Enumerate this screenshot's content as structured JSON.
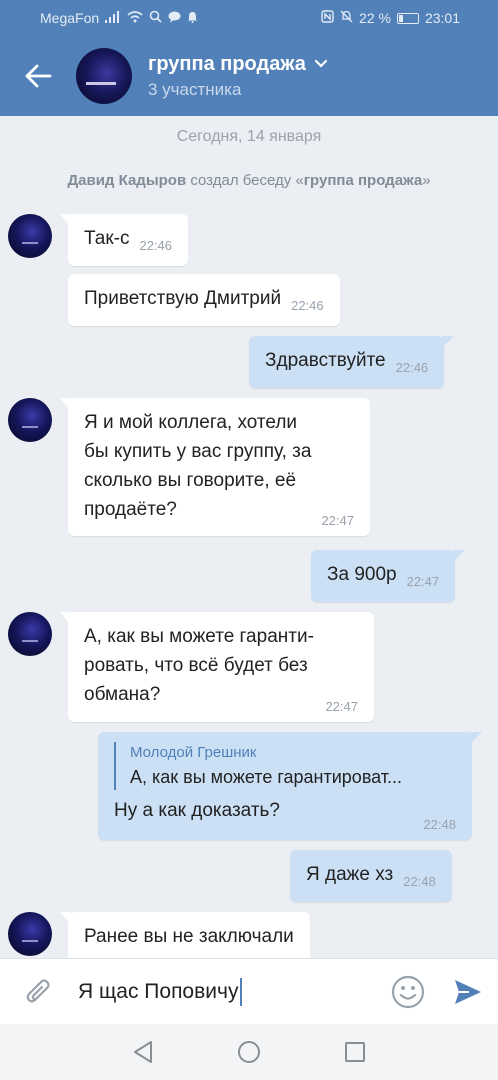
{
  "status_bar": {
    "carrier": "MegaFon",
    "battery": "22 %",
    "time": "23:01"
  },
  "header": {
    "title": "группа продажа",
    "subtitle": "3 участника"
  },
  "chat": {
    "date_separator": "Сегодня, 14 января",
    "system_message": {
      "author": "Давид Кадыров",
      "action": " создал беседу «",
      "chat_name": "группа продажа",
      "end": "»"
    },
    "messages": [
      {
        "direction": "in",
        "text": "Так-с",
        "time": "22:46"
      },
      {
        "direction": "in",
        "text": "Приветствую Дмитрий",
        "time": "22:46"
      },
      {
        "direction": "out",
        "text": "Здравствуйте",
        "time": "22:46"
      },
      {
        "direction": "in",
        "lines": [
          "Я и мой коллега, хотели",
          "бы купить у вас группу, за",
          "сколько вы говорите, её",
          "продаёте?"
        ],
        "time": "22:47"
      },
      {
        "direction": "out",
        "text": "За 900р",
        "time": "22:47"
      },
      {
        "direction": "in",
        "lines": [
          "А, как вы можете гаранти-",
          "ровать, что всё будет без",
          "обмана?"
        ],
        "time": "22:47"
      },
      {
        "direction": "out",
        "reply_name": "Молодой Грешник",
        "reply_text": "А, как вы можете гарантироват...",
        "text": "Ну а как доказать?",
        "time": "22:48"
      },
      {
        "direction": "out",
        "text": "Я даже хз",
        "time": "22:48"
      },
      {
        "direction": "in",
        "text": "Ранее вы не заключали",
        "time": ""
      }
    ]
  },
  "composer": {
    "value": "Я щас Поповичу"
  },
  "colors": {
    "brand": "#5181b8",
    "outgoing_bubble": "#cce0f5",
    "background": "#ebeef2"
  }
}
